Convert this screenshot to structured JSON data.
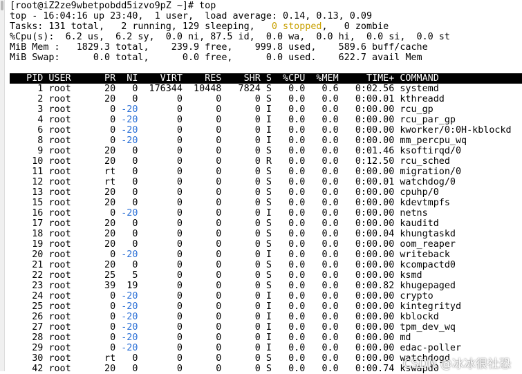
{
  "colors": {
    "background": "#ffffff",
    "text": "#000000",
    "header_bg": "#000000",
    "header_text": "#ffffff",
    "stopped_text": "#c8a000",
    "negative_ni_text": "#2a6fd6"
  },
  "prompt": {
    "text": "[root@iZ2ze9wbetpobdd5izvo9pZ ~]# top"
  },
  "summary": {
    "uptime_line": "top - 16:04:16 up 23:40,  1 user,  load average: 0.14, 0.13, 0.09",
    "tasks": {
      "prefix": "Tasks: 131 total,   2 running, 129 sleeping,   ",
      "stopped": "0 stopped",
      "suffix": ",   0 zombie"
    },
    "cpu_line": "%Cpu(s):  6.2 us,  6.2 sy,  0.0 ni, 87.5 id,  0.0 wa,  0.0 hi,  0.0 si,  0.0 st",
    "mem_line": "MiB Mem :   1829.3 total,    239.9 free,    999.8 used,    589.6 buff/cache",
    "swap_line": "MiB Swap:      0.0 total,      0.0 free,      0.0 used.    622.7 avail Mem"
  },
  "table": {
    "header": "   PID USER      PR  NI    VIRT    RES    SHR S  %CPU  %MEM     TIME+ COMMAND",
    "rows": [
      {
        "pid": "1",
        "user": "root",
        "pr": "20",
        "ni": "0",
        "virt": "176344",
        "res": "10448",
        "shr": "7824",
        "s": "S",
        "cpu": "0.0",
        "mem": "0.6",
        "time": "0:02.56",
        "cmd": "systemd"
      },
      {
        "pid": "2",
        "user": "root",
        "pr": "20",
        "ni": "0",
        "virt": "0",
        "res": "0",
        "shr": "0",
        "s": "S",
        "cpu": "0.0",
        "mem": "0.0",
        "time": "0:00.01",
        "cmd": "kthreadd"
      },
      {
        "pid": "3",
        "user": "root",
        "pr": "0",
        "ni": "-20",
        "virt": "0",
        "res": "0",
        "shr": "0",
        "s": "I",
        "cpu": "0.0",
        "mem": "0.0",
        "time": "0:00.00",
        "cmd": "rcu_gp"
      },
      {
        "pid": "4",
        "user": "root",
        "pr": "0",
        "ni": "-20",
        "virt": "0",
        "res": "0",
        "shr": "0",
        "s": "I",
        "cpu": "0.0",
        "mem": "0.0",
        "time": "0:00.00",
        "cmd": "rcu_par_gp"
      },
      {
        "pid": "6",
        "user": "root",
        "pr": "0",
        "ni": "-20",
        "virt": "0",
        "res": "0",
        "shr": "0",
        "s": "I",
        "cpu": "0.0",
        "mem": "0.0",
        "time": "0:00.00",
        "cmd": "kworker/0:0H-kblockd"
      },
      {
        "pid": "8",
        "user": "root",
        "pr": "0",
        "ni": "-20",
        "virt": "0",
        "res": "0",
        "shr": "0",
        "s": "I",
        "cpu": "0.0",
        "mem": "0.0",
        "time": "0:00.00",
        "cmd": "mm_percpu_wq"
      },
      {
        "pid": "9",
        "user": "root",
        "pr": "20",
        "ni": "0",
        "virt": "0",
        "res": "0",
        "shr": "0",
        "s": "S",
        "cpu": "0.0",
        "mem": "0.0",
        "time": "0:01.46",
        "cmd": "ksoftirqd/0"
      },
      {
        "pid": "10",
        "user": "root",
        "pr": "20",
        "ni": "0",
        "virt": "0",
        "res": "0",
        "shr": "0",
        "s": "R",
        "cpu": "0.0",
        "mem": "0.0",
        "time": "0:12.50",
        "cmd": "rcu_sched"
      },
      {
        "pid": "11",
        "user": "root",
        "pr": "rt",
        "ni": "0",
        "virt": "0",
        "res": "0",
        "shr": "0",
        "s": "S",
        "cpu": "0.0",
        "mem": "0.0",
        "time": "0:00.00",
        "cmd": "migration/0"
      },
      {
        "pid": "12",
        "user": "root",
        "pr": "rt",
        "ni": "0",
        "virt": "0",
        "res": "0",
        "shr": "0",
        "s": "S",
        "cpu": "0.0",
        "mem": "0.0",
        "time": "0:00.01",
        "cmd": "watchdog/0"
      },
      {
        "pid": "13",
        "user": "root",
        "pr": "20",
        "ni": "0",
        "virt": "0",
        "res": "0",
        "shr": "0",
        "s": "S",
        "cpu": "0.0",
        "mem": "0.0",
        "time": "0:00.00",
        "cmd": "cpuhp/0"
      },
      {
        "pid": "15",
        "user": "root",
        "pr": "20",
        "ni": "0",
        "virt": "0",
        "res": "0",
        "shr": "0",
        "s": "S",
        "cpu": "0.0",
        "mem": "0.0",
        "time": "0:00.00",
        "cmd": "kdevtmpfs"
      },
      {
        "pid": "16",
        "user": "root",
        "pr": "0",
        "ni": "-20",
        "virt": "0",
        "res": "0",
        "shr": "0",
        "s": "I",
        "cpu": "0.0",
        "mem": "0.0",
        "time": "0:00.00",
        "cmd": "netns"
      },
      {
        "pid": "17",
        "user": "root",
        "pr": "20",
        "ni": "0",
        "virt": "0",
        "res": "0",
        "shr": "0",
        "s": "S",
        "cpu": "0.0",
        "mem": "0.0",
        "time": "0:00.00",
        "cmd": "kauditd"
      },
      {
        "pid": "18",
        "user": "root",
        "pr": "20",
        "ni": "0",
        "virt": "0",
        "res": "0",
        "shr": "0",
        "s": "S",
        "cpu": "0.0",
        "mem": "0.0",
        "time": "0:00.04",
        "cmd": "khungtaskd"
      },
      {
        "pid": "19",
        "user": "root",
        "pr": "20",
        "ni": "0",
        "virt": "0",
        "res": "0",
        "shr": "0",
        "s": "S",
        "cpu": "0.0",
        "mem": "0.0",
        "time": "0:00.00",
        "cmd": "oom_reaper"
      },
      {
        "pid": "20",
        "user": "root",
        "pr": "0",
        "ni": "-20",
        "virt": "0",
        "res": "0",
        "shr": "0",
        "s": "I",
        "cpu": "0.0",
        "mem": "0.0",
        "time": "0:00.00",
        "cmd": "writeback"
      },
      {
        "pid": "21",
        "user": "root",
        "pr": "20",
        "ni": "0",
        "virt": "0",
        "res": "0",
        "shr": "0",
        "s": "S",
        "cpu": "0.0",
        "mem": "0.0",
        "time": "0:00.00",
        "cmd": "kcompactd0"
      },
      {
        "pid": "22",
        "user": "root",
        "pr": "25",
        "ni": "5",
        "virt": "0",
        "res": "0",
        "shr": "0",
        "s": "S",
        "cpu": "0.0",
        "mem": "0.0",
        "time": "0:00.00",
        "cmd": "ksmd"
      },
      {
        "pid": "23",
        "user": "root",
        "pr": "39",
        "ni": "19",
        "virt": "0",
        "res": "0",
        "shr": "0",
        "s": "S",
        "cpu": "0.0",
        "mem": "0.0",
        "time": "0:00.82",
        "cmd": "khugepaged"
      },
      {
        "pid": "24",
        "user": "root",
        "pr": "0",
        "ni": "-20",
        "virt": "0",
        "res": "0",
        "shr": "0",
        "s": "I",
        "cpu": "0.0",
        "mem": "0.0",
        "time": "0:00.00",
        "cmd": "crypto"
      },
      {
        "pid": "25",
        "user": "root",
        "pr": "0",
        "ni": "-20",
        "virt": "0",
        "res": "0",
        "shr": "0",
        "s": "I",
        "cpu": "0.0",
        "mem": "0.0",
        "time": "0:00.00",
        "cmd": "kintegrityd"
      },
      {
        "pid": "26",
        "user": "root",
        "pr": "0",
        "ni": "-20",
        "virt": "0",
        "res": "0",
        "shr": "0",
        "s": "I",
        "cpu": "0.0",
        "mem": "0.0",
        "time": "0:00.00",
        "cmd": "kblockd"
      },
      {
        "pid": "27",
        "user": "root",
        "pr": "0",
        "ni": "-20",
        "virt": "0",
        "res": "0",
        "shr": "0",
        "s": "I",
        "cpu": "0.0",
        "mem": "0.0",
        "time": "0:00.00",
        "cmd": "tpm_dev_wq"
      },
      {
        "pid": "28",
        "user": "root",
        "pr": "0",
        "ni": "-20",
        "virt": "0",
        "res": "0",
        "shr": "0",
        "s": "I",
        "cpu": "0.0",
        "mem": "0.0",
        "time": "0:00.00",
        "cmd": "md"
      },
      {
        "pid": "29",
        "user": "root",
        "pr": "0",
        "ni": "-20",
        "virt": "0",
        "res": "0",
        "shr": "0",
        "s": "I",
        "cpu": "0.0",
        "mem": "0.0",
        "time": "0:00.00",
        "cmd": "edac-poller"
      },
      {
        "pid": "30",
        "user": "root",
        "pr": "rt",
        "ni": "0",
        "virt": "0",
        "res": "0",
        "shr": "0",
        "s": "S",
        "cpu": "0.0",
        "mem": "0.0",
        "time": "0:00.00",
        "cmd": "watchdogd"
      },
      {
        "pid": "42",
        "user": "root",
        "pr": "20",
        "ni": "0",
        "virt": "0",
        "res": "0",
        "shr": "0",
        "s": "S",
        "cpu": "0.0",
        "mem": "0.0",
        "time": "0:00.74",
        "cmd": "kswapd0"
      }
    ]
  },
  "watermark": {
    "text": "CSDN @冰冰很社恐"
  }
}
